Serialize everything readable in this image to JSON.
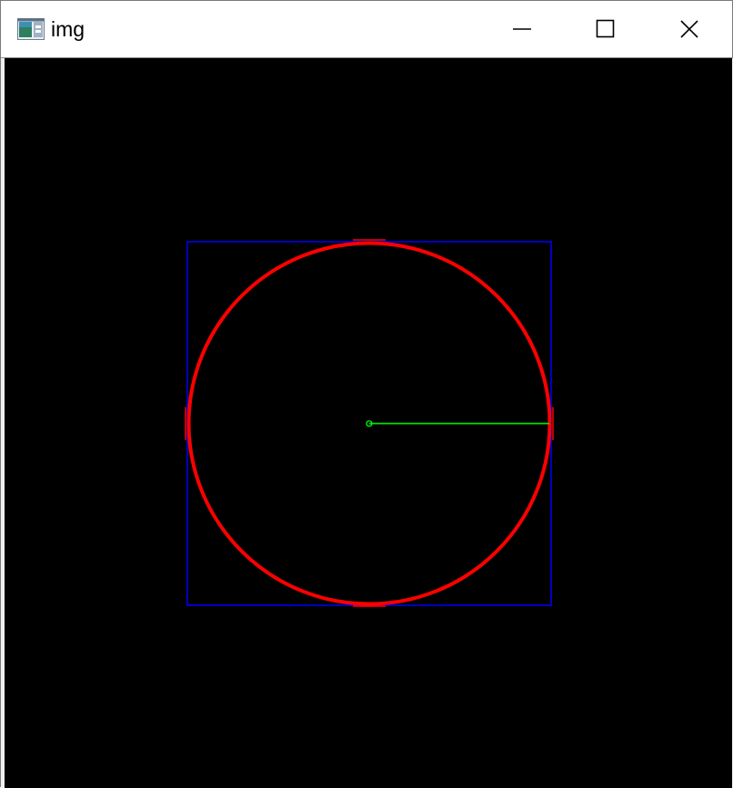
{
  "window": {
    "title": "img",
    "icon": "app-window-icon"
  },
  "titlebar_buttons": {
    "minimize": "minimize-icon",
    "maximize": "maximize-icon",
    "close": "close-icon"
  },
  "image": {
    "background_color": "#000000",
    "square_color": "#0000ff",
    "circle_color": "#ff0000",
    "radius_line_color": "#00ff00",
    "center_marker_color": "#00ff00"
  }
}
